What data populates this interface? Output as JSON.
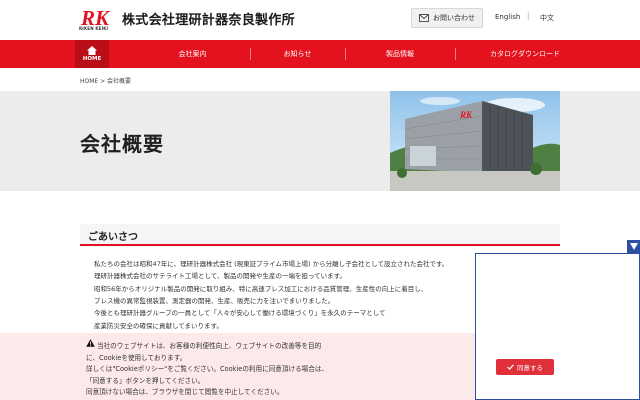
{
  "header": {
    "logo_text": "RK",
    "logo_sub": "RIKEN KEIKI",
    "company_name": "株式会社理研計器奈良製作所",
    "contact_label": "お問い合わせ",
    "lang_en": "English",
    "lang_sep": "|",
    "lang_zh": "中文"
  },
  "nav": {
    "home_label": "HOME",
    "items": [
      "会社案内",
      "お知らせ",
      "製品情報",
      "カタログダウンロード"
    ]
  },
  "breadcrumb": "HOME > 会社概要",
  "hero": {
    "title": "会社概要"
  },
  "section": {
    "title": "ごあいさつ",
    "paragraphs": [
      "私たちの会社は昭和47年に、理研計器株式会社 (現東証プライム市場上場) から分離し子会社として設立された会社です。",
      "理研計器株式会社のサテライト工場として、製品の開発や生産の一端を担っています。",
      "昭和56年からオリジナル製品の開発に取り組み、特に高速プレス加工における品質管理、生産性の向上に着目し、",
      "プレス機の異常監視装置、測定器の開発、生産、販売に力を注いでまいりました。",
      "今後とも理研計器グループの一員として「人々が安心して働ける環境づくり」を永久のテーマとして",
      "産業防災安全の確保に貢献してまいります。"
    ]
  },
  "cookie": {
    "lines": [
      "当社のウェブサイトは、お客様の利便性向上、ウェブサイトの改善等を目的",
      "に、Cookieを使用しております。",
      "詳しくは\"Cookieポリシー\"をご覧ください。Cookieの利用に同意頂ける場合は、",
      "「同意する」ボタンを押してください。",
      "同意頂けない場合は、ブラウザを閉じて閲覧を中止してください。"
    ],
    "agree_label": "同意する"
  },
  "colors": {
    "brand_red": "#e3121e",
    "panel_blue": "#2b4fa3"
  }
}
